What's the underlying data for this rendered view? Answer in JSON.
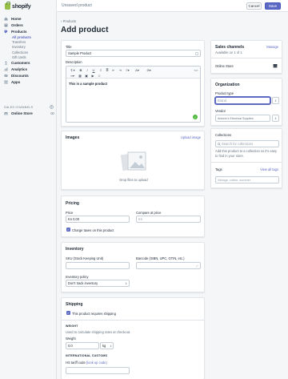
{
  "brand": {
    "name": "shopify"
  },
  "topbar": {
    "title": "Unsaved product",
    "cancel": "Cancel",
    "save": "Save"
  },
  "nav": {
    "items": [
      {
        "label": "Home",
        "icon": "home-icon"
      },
      {
        "label": "Orders",
        "icon": "orders-icon"
      },
      {
        "label": "Products",
        "icon": "tag-icon"
      }
    ],
    "subitems": [
      "All products",
      "Transfers",
      "Inventory",
      "Collections",
      "Gift cards"
    ],
    "items2": [
      {
        "label": "Customers",
        "icon": "customers-icon"
      },
      {
        "label": "Analytics",
        "icon": "analytics-icon"
      },
      {
        "label": "Discounts",
        "icon": "discounts-icon"
      },
      {
        "label": "Apps",
        "icon": "apps-icon"
      }
    ],
    "channels_heading": "SALES CHANNELS",
    "online_store": "Online Store"
  },
  "breadcrumb": "Products",
  "page_title": "Add product",
  "product": {
    "title_label": "Title",
    "title_value": "Sample Product",
    "description_label": "Description",
    "description_value": "This is a sample product"
  },
  "images": {
    "heading": "Images",
    "upload_link": "Upload image",
    "drop_text": "Drop files to upload"
  },
  "pricing": {
    "heading": "Pricing",
    "price_label": "Price",
    "price_value": "Kn 0,00",
    "compare_label": "Compare at price",
    "compare_value": "Kn",
    "charge_taxes": "Charge taxes on this product"
  },
  "inventory": {
    "heading": "Inventory",
    "sku_label": "SKU (Stock Keeping Unit)",
    "barcode_label": "Barcode (ISBN, UPC, GTIN, etc.)",
    "policy_label": "Inventory policy",
    "policy_value": "Don't track inventory"
  },
  "shipping": {
    "heading": "Shipping",
    "requires": "This product requires shipping",
    "weight_heading": "WEIGHT",
    "weight_help": "Used to calculate shipping rates at checkout.",
    "weight_label": "Weight",
    "weight_value": "0.0",
    "weight_unit": "kg",
    "customs_heading": "INTERNATIONAL CUSTOMS",
    "hs_label": "HS tariff code",
    "hs_link": "(look up code)"
  },
  "sales_channels": {
    "heading": "Sales channels",
    "manage": "Manage",
    "available": "Available on 1 of 1",
    "online_store": "Online Store"
  },
  "organization": {
    "heading": "Organization",
    "type_label": "Product type",
    "type_placeholder": "Brand",
    "vendor_label": "Vendor",
    "vendor_value": "Antonic's Electrical Supplies"
  },
  "collections": {
    "heading": "Collections",
    "search_placeholder": "Search for collections",
    "help": "Add this product to a collection so it's easy to find in your store."
  },
  "tags": {
    "heading": "Tags",
    "view_all": "View all tags",
    "placeholder": "Vintage, cotton, summer"
  },
  "colors": {
    "accent": "#5c6ac4",
    "brand_green": "#95bf47"
  }
}
